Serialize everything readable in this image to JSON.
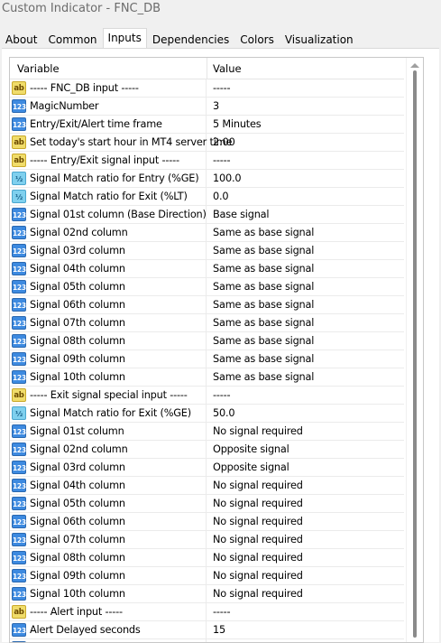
{
  "window": {
    "title": "Custom Indicator - FNC_DB"
  },
  "tabs": [
    {
      "label": "About"
    },
    {
      "label": "Common"
    },
    {
      "label": "Inputs",
      "active": true
    },
    {
      "label": "Dependencies"
    },
    {
      "label": "Colors"
    },
    {
      "label": "Visualization"
    }
  ],
  "grid": {
    "columns": {
      "variable": "Variable",
      "value": "Value"
    },
    "rows": [
      {
        "type": "ab",
        "icon": "string-type-icon",
        "name": "----- FNC_DB input -----",
        "value": "-----"
      },
      {
        "type": "123",
        "icon": "integer-type-icon",
        "name": "MagicNumber",
        "value": "3"
      },
      {
        "type": "123",
        "icon": "integer-type-icon",
        "name": "Entry/Exit/Alert time frame",
        "value": "5 Minutes"
      },
      {
        "type": "ab",
        "icon": "string-type-icon",
        "name": "Set today's start hour in MT4 server time",
        "value": "2:00"
      },
      {
        "type": "ab",
        "icon": "string-type-icon",
        "name": "----- Entry/Exit signal input -----",
        "value": "-----"
      },
      {
        "type": "half",
        "icon": "double-type-icon",
        "name": "Signal Match ratio for Entry (%GE)",
        "value": "100.0"
      },
      {
        "type": "half",
        "icon": "double-type-icon",
        "name": "Signal Match ratio for Exit (%LT)",
        "value": "0.0"
      },
      {
        "type": "123",
        "icon": "integer-type-icon",
        "name": "Signal 01st column (Base Direction)",
        "value": "Base signal"
      },
      {
        "type": "123",
        "icon": "integer-type-icon",
        "name": "Signal 02nd column",
        "value": "Same as base signal"
      },
      {
        "type": "123",
        "icon": "integer-type-icon",
        "name": "Signal 03rd column",
        "value": "Same as base signal"
      },
      {
        "type": "123",
        "icon": "integer-type-icon",
        "name": "Signal 04th column",
        "value": "Same as base signal"
      },
      {
        "type": "123",
        "icon": "integer-type-icon",
        "name": "Signal 05th column",
        "value": "Same as base signal"
      },
      {
        "type": "123",
        "icon": "integer-type-icon",
        "name": "Signal 06th column",
        "value": "Same as base signal"
      },
      {
        "type": "123",
        "icon": "integer-type-icon",
        "name": "Signal 07th column",
        "value": "Same as base signal"
      },
      {
        "type": "123",
        "icon": "integer-type-icon",
        "name": "Signal 08th column",
        "value": "Same as base signal"
      },
      {
        "type": "123",
        "icon": "integer-type-icon",
        "name": "Signal 09th column",
        "value": "Same as base signal"
      },
      {
        "type": "123",
        "icon": "integer-type-icon",
        "name": "Signal 10th column",
        "value": "Same as base signal"
      },
      {
        "type": "ab",
        "icon": "string-type-icon",
        "name": "----- Exit signal special input -----",
        "value": "-----"
      },
      {
        "type": "half",
        "icon": "double-type-icon",
        "name": "Signal Match ratio for Exit (%GE)",
        "value": "50.0"
      },
      {
        "type": "123",
        "icon": "integer-type-icon",
        "name": "Signal 01st column",
        "value": "No signal required"
      },
      {
        "type": "123",
        "icon": "integer-type-icon",
        "name": "Signal 02nd column",
        "value": "Opposite signal"
      },
      {
        "type": "123",
        "icon": "integer-type-icon",
        "name": "Signal 03rd column",
        "value": "Opposite signal"
      },
      {
        "type": "123",
        "icon": "integer-type-icon",
        "name": "Signal 04th column",
        "value": "No signal required"
      },
      {
        "type": "123",
        "icon": "integer-type-icon",
        "name": "Signal 05th column",
        "value": "No signal required"
      },
      {
        "type": "123",
        "icon": "integer-type-icon",
        "name": "Signal 06th column",
        "value": "No signal required"
      },
      {
        "type": "123",
        "icon": "integer-type-icon",
        "name": "Signal 07th column",
        "value": "No signal required"
      },
      {
        "type": "123",
        "icon": "integer-type-icon",
        "name": "Signal 08th column",
        "value": "No signal required"
      },
      {
        "type": "123",
        "icon": "integer-type-icon",
        "name": "Signal 09th column",
        "value": "No signal required"
      },
      {
        "type": "123",
        "icon": "integer-type-icon",
        "name": "Signal 10th column",
        "value": "No signal required"
      },
      {
        "type": "ab",
        "icon": "string-type-icon",
        "name": "----- Alert input -----",
        "value": "-----"
      },
      {
        "type": "123",
        "icon": "integer-type-icon",
        "name": "Alert Delayed seconds",
        "value": "15"
      },
      {
        "type": "123",
        "icon": "integer-type-icon",
        "name": "",
        "value": ""
      }
    ]
  },
  "icon_glyphs": {
    "ab": "ab",
    "123": "123",
    "half": "½"
  },
  "colors": {
    "string_icon": "#f0dc6a",
    "integer_icon": "#3d8ae0",
    "double_icon": "#7fd0ee"
  }
}
